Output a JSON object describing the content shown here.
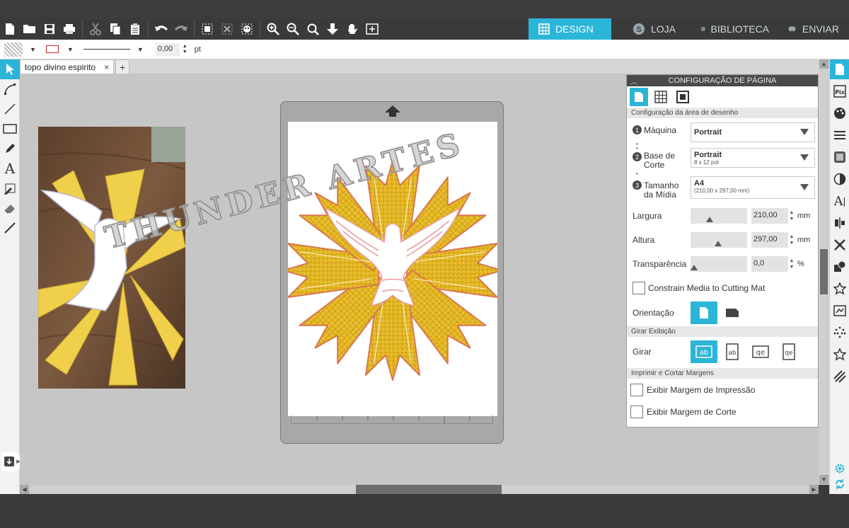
{
  "nav": {
    "tabs": [
      {
        "label": "DESIGN",
        "active": true
      },
      {
        "label": "LOJA",
        "active": false
      },
      {
        "label": "BIBLIOTECA",
        "active": false
      },
      {
        "label": "ENVIAR",
        "active": false
      }
    ]
  },
  "stylebar": {
    "line_width": "0,00",
    "unit": "pt"
  },
  "document_tab": {
    "name": "topo divino espirito",
    "close": "×",
    "add": "+"
  },
  "canvas": {
    "watermark": "THUNDER ARTES"
  },
  "panel": {
    "title": "CONFIGURAÇÃO DE PÁGINA",
    "section_drawing_area": "Configuração da área de desenho",
    "machine": {
      "step": "1",
      "label": "Máquina",
      "value": "Portrait"
    },
    "cut_base": {
      "step": "2",
      "label": "Base de Corte",
      "value": "Portrait",
      "detail": "8 x 12 pol"
    },
    "media_size": {
      "step": "3",
      "label": "Tamanho da Mídia",
      "value": "A4",
      "detail": "(210,00 x 297,00 mm)"
    },
    "width": {
      "label": "Largura",
      "value": "210,00",
      "unit": "mm"
    },
    "height": {
      "label": "Altura",
      "value": "297,00",
      "unit": "mm"
    },
    "transparency": {
      "label": "Transparência",
      "value": "0,0",
      "unit": "%"
    },
    "constrain_label": "Constrain Media to Cutting Mat",
    "orientation_label": "Orientação",
    "section_rotate_view": "Girar Exibição",
    "rotate_label": "Girar",
    "section_print_cut": "Imprimir e Cortar Margens",
    "print_margin_label": "Exibir Margem de Impressão",
    "cut_margin_label": "Exibir Margem de Corte"
  },
  "colors": {
    "accent": "#2bb5d8",
    "toolbar_bg": "#3a3a3a",
    "canvas_bg": "#c6c6c6",
    "gold": "#e0b21e",
    "copper": "#d9774f",
    "dove_outline": "#e89aa0"
  }
}
